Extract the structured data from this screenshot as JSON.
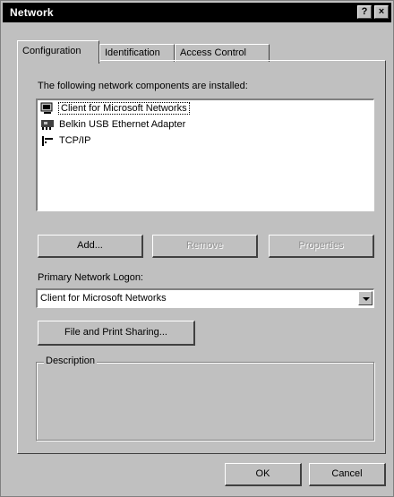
{
  "window": {
    "title": "Network",
    "help_label": "?",
    "close_label": "×"
  },
  "tabs": [
    {
      "label": "Configuration",
      "active": true
    },
    {
      "label": "Identification",
      "active": false
    },
    {
      "label": "Access Control",
      "active": false
    }
  ],
  "components": {
    "label": "The following network components are installed:",
    "items": [
      {
        "label": "Client for Microsoft Networks",
        "icon": "client-icon",
        "selected": true
      },
      {
        "label": "Belkin USB Ethernet Adapter",
        "icon": "network-adapter-icon",
        "selected": false
      },
      {
        "label": "TCP/IP",
        "icon": "protocol-icon",
        "selected": false
      }
    ]
  },
  "buttons": {
    "add": "Add...",
    "remove": "Remove",
    "properties": "Properties",
    "file_print_sharing": "File and Print Sharing...",
    "ok": "OK",
    "cancel": "Cancel"
  },
  "logon": {
    "label": "Primary Network Logon:",
    "value": "Client for Microsoft Networks"
  },
  "description": {
    "legend": "Description",
    "text": ""
  }
}
